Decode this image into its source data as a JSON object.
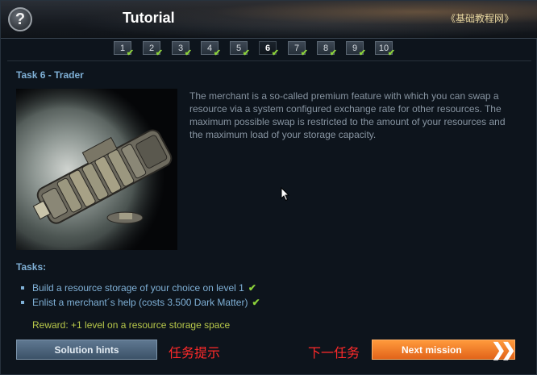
{
  "header": {
    "help_label": "?",
    "title": "Tutorial",
    "brand": "《基础教程网》"
  },
  "steps": [
    {
      "label": "1",
      "completed": true,
      "active": false
    },
    {
      "label": "2",
      "completed": true,
      "active": false
    },
    {
      "label": "3",
      "completed": true,
      "active": false
    },
    {
      "label": "4",
      "completed": true,
      "active": false
    },
    {
      "label": "5",
      "completed": true,
      "active": false
    },
    {
      "label": "6",
      "completed": true,
      "active": true
    },
    {
      "label": "7",
      "completed": true,
      "active": false
    },
    {
      "label": "8",
      "completed": true,
      "active": false
    },
    {
      "label": "9",
      "completed": true,
      "active": false
    },
    {
      "label": "10",
      "completed": true,
      "active": false
    }
  ],
  "task": {
    "title": "Task 6 - Trader",
    "description": "The merchant is a so-called premium feature with which you can swap a resource via a system configured exchange rate for other resources. The maximum possible swap is restricted to the amount of your resources and the maximum load of your storage capacity.",
    "tasks_heading": "Tasks:",
    "items": [
      {
        "text": "Build a resource storage of your choice on level 1",
        "done": true
      },
      {
        "text": "Enlist a merchant´s help (costs 3.500 Dark Matter)",
        "done": true
      }
    ],
    "reward": "Reward: +1 level on a resource storage space"
  },
  "footer": {
    "hints_button": "Solution hints",
    "hints_annotation": "任务提示",
    "next_annotation": "下一任务",
    "next_button": "Next mission",
    "next_arrows": "❯❯"
  },
  "icons": {
    "help": "question-mark-icon",
    "check": "checkmark-icon",
    "next": "double-chevron-right-icon"
  },
  "colors": {
    "accent_blue": "#7fb0d6",
    "check_green": "#8cd23a",
    "reward_yellow": "#b9c94a",
    "next_orange": "#e2641a",
    "annotation_red": "#ff2a2a"
  }
}
